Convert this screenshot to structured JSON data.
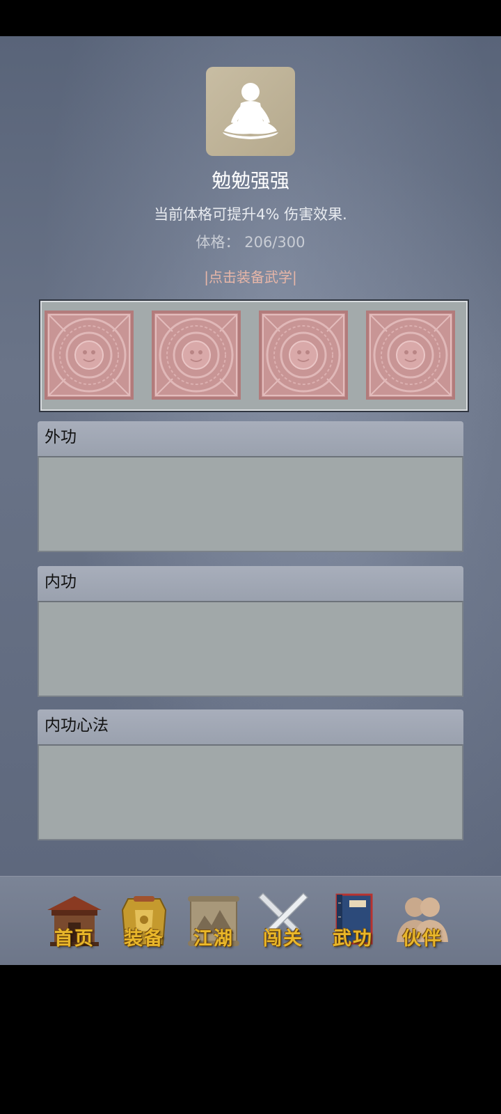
{
  "header": {
    "title": "勉勉强强",
    "description": "当前体格可提升4% 伤害效果.",
    "stat_label": "体格：",
    "stat_value": "206/300",
    "equip_link": "|点击装备武学|"
  },
  "avatar": {
    "icon": "meditating-figure-icon"
  },
  "equip_slots": [
    {
      "icon": "aztec-calendar-icon"
    },
    {
      "icon": "aztec-calendar-icon"
    },
    {
      "icon": "aztec-calendar-icon"
    },
    {
      "icon": "aztec-calendar-icon"
    }
  ],
  "sections": [
    {
      "title": "外功"
    },
    {
      "title": "内功"
    },
    {
      "title": "内功心法"
    }
  ],
  "bottom_nav": [
    {
      "label": "首页",
      "icon": "pavilion-icon"
    },
    {
      "label": "装备",
      "icon": "armor-icon"
    },
    {
      "label": "江湖",
      "icon": "scroll-map-icon"
    },
    {
      "label": "闯关",
      "icon": "crossed-swords-icon"
    },
    {
      "label": "武功",
      "icon": "book-icon"
    },
    {
      "label": "伙伴",
      "icon": "companions-icon"
    }
  ],
  "colors": {
    "background": "#636d81",
    "slot_tint": "#c89595",
    "nav_label": "#e8b62a",
    "equip_link": "#e7b6a8"
  }
}
